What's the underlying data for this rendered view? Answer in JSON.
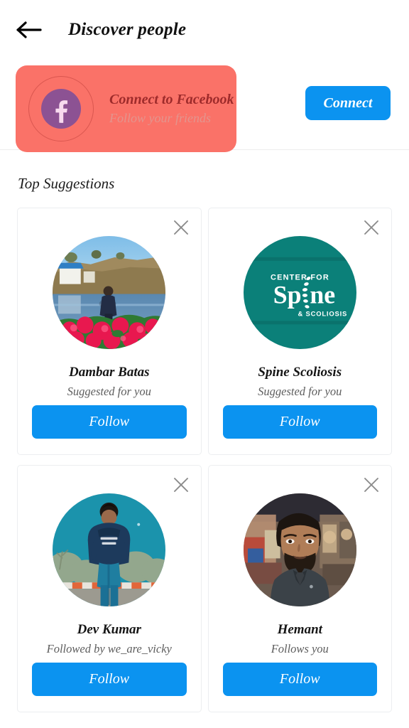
{
  "header": {
    "back_icon": "arrow-left-icon",
    "title": "Discover people"
  },
  "facebook_banner": {
    "icon": "facebook-icon",
    "title": "Connect to Facebook",
    "subtitle": "Follow your friends",
    "connect_label": "Connect",
    "background_color": "#fa7268",
    "title_color": "#9e2b2b",
    "subtitle_color": "#e3958e",
    "badge_color": "#8c5293",
    "button_color": "#0b93f0"
  },
  "suggestions": {
    "section_title": "Top Suggestions",
    "follow_label": "Follow",
    "close_icon": "close-icon",
    "accent_color": "#0b93f0",
    "cards": [
      {
        "name": "Dambar Batas",
        "meta": "Suggested for you",
        "avatar": "landscape-lake-flowers-photo",
        "follow_label": "Follow"
      },
      {
        "name": "Spine Scoliosis",
        "meta": "Suggested for you",
        "avatar": "spine-scoliosis-logo",
        "logo_color": "#0b7f7a",
        "logo_line1": "CENTER FOR",
        "logo_line2": "Sp ne",
        "logo_line3": "& SCOLIOSIS",
        "follow_label": "Follow"
      },
      {
        "name": "Dev Kumar",
        "meta": "Followed by we_are_vicky",
        "avatar": "man-navy-hoodie-photo",
        "follow_label": "Follow"
      },
      {
        "name": "Hemant",
        "meta": "Follows you",
        "avatar": "bearded-man-suit-photo",
        "follow_label": "Follow"
      }
    ]
  }
}
